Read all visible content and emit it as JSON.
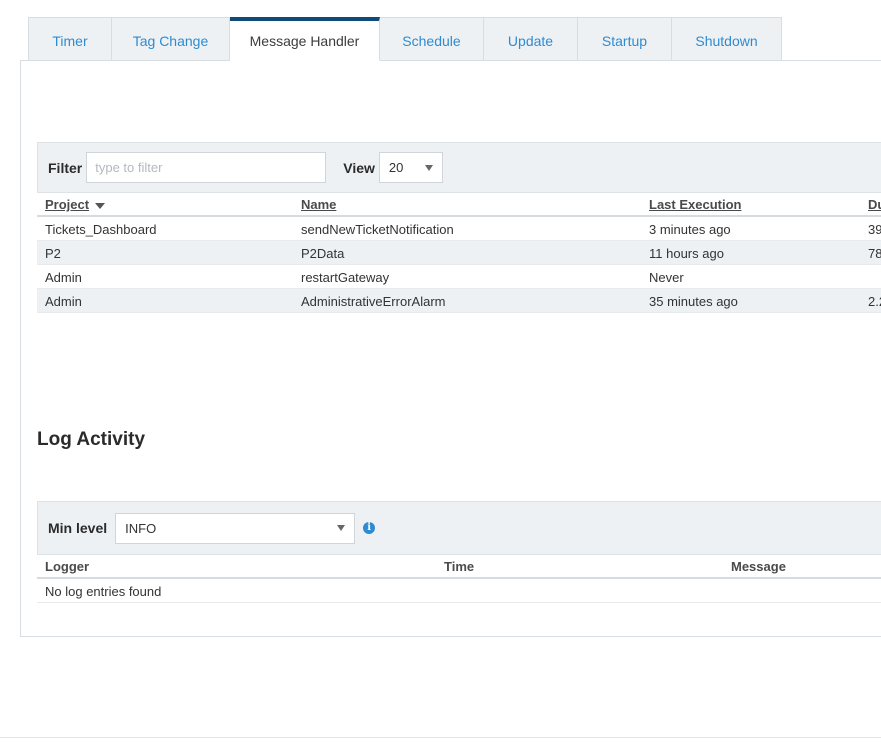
{
  "tabs": [
    {
      "label": "Timer",
      "active": false
    },
    {
      "label": "Tag Change",
      "active": false
    },
    {
      "label": "Message Handler",
      "active": true
    },
    {
      "label": "Schedule",
      "active": false
    },
    {
      "label": "Update",
      "active": false
    },
    {
      "label": "Startup",
      "active": false
    },
    {
      "label": "Shutdown",
      "active": false
    }
  ],
  "scripts_toolbar": {
    "filter_label": "Filter",
    "filter_placeholder": "type to filter",
    "filter_value": "",
    "view_label": "View",
    "view_value": "20"
  },
  "scripts_table": {
    "columns": [
      "Project",
      "Name",
      "Last Execution",
      "Du"
    ],
    "sorted_column": "Project",
    "rows": [
      {
        "project": "Tickets_Dashboard",
        "name": "sendNewTicketNotification",
        "last_execution": "3 minutes ago",
        "duration": "39"
      },
      {
        "project": "P2",
        "name": "P2Data",
        "last_execution": "11 hours ago",
        "duration": "78"
      },
      {
        "project": "Admin",
        "name": "restartGateway",
        "last_execution": "Never",
        "duration": ""
      },
      {
        "project": "Admin",
        "name": "AdministrativeErrorAlarm",
        "last_execution": "35 minutes ago",
        "duration": "2.2"
      }
    ]
  },
  "log_activity": {
    "title": "Log Activity",
    "min_level_label": "Min level",
    "min_level_value": "INFO",
    "info_icon": "info-icon",
    "columns": [
      "Logger",
      "Time",
      "Message"
    ],
    "empty_message": "No log entries found"
  },
  "colors": {
    "accent": "#2e8bd0",
    "active_tab_border": "#0e4b78",
    "toolbar_bg": "#eef1f4"
  }
}
